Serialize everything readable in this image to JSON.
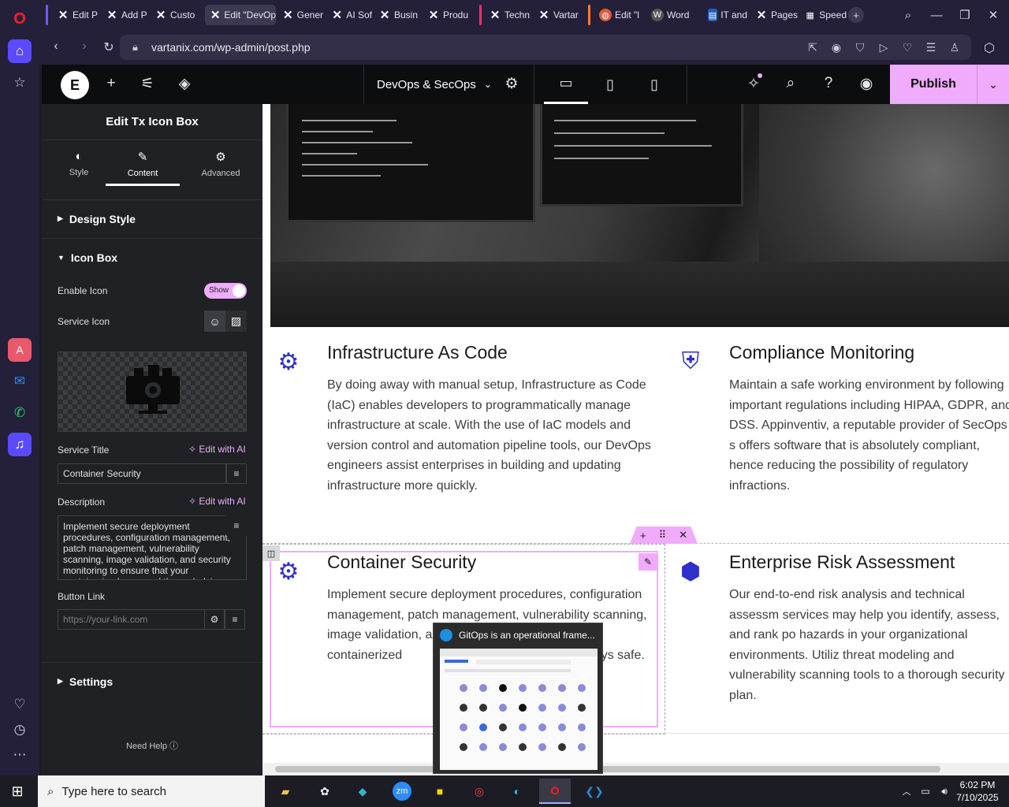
{
  "browser": {
    "tabs": [
      {
        "label": "Edit P",
        "icon": "x-logo-icon"
      },
      {
        "label": "Add P",
        "icon": "x-logo-icon"
      },
      {
        "label": "Custo",
        "icon": "x-logo-icon"
      },
      {
        "label": "Edit \"DevOp",
        "icon": "x-logo-icon",
        "active": true
      },
      {
        "label": "Gener",
        "icon": "x-logo-icon"
      },
      {
        "label": "AI Sof",
        "icon": "x-logo-icon"
      },
      {
        "label": "Busin",
        "icon": "x-logo-icon"
      },
      {
        "label": "Produ",
        "icon": "x-logo-icon"
      },
      {
        "label": "Techn",
        "icon": "x-logo-icon"
      },
      {
        "label": "Vartar",
        "icon": "x-logo-icon"
      },
      {
        "label": "Edit \"l",
        "icon": "globe-icon"
      },
      {
        "label": "Word",
        "icon": "wordpress-icon"
      },
      {
        "label": "IT and",
        "icon": "doc-icon"
      },
      {
        "label": "Pages",
        "icon": "x-logo-icon"
      },
      {
        "label": "Speed",
        "icon": "grid-icon"
      }
    ],
    "url": "vartanix.com/wp-admin/post.php"
  },
  "elementor": {
    "page_name": "DevOps & SecOps",
    "publish_label": "Publish"
  },
  "panel": {
    "title": "Edit Tx Icon Box",
    "tabs": [
      {
        "label": "Style"
      },
      {
        "label": "Content"
      },
      {
        "label": "Advanced"
      }
    ],
    "design_style": "Design Style",
    "icon_box": "Icon Box",
    "enable_icon_label": "Enable Icon",
    "enable_icon_value": "Show",
    "service_icon_label": "Service Icon",
    "service_title_label": "Service Title",
    "edit_with_ai": "Edit with AI",
    "service_title_value": "Container Security",
    "description_label": "Description",
    "description_value": "Implement secure deployment procedures, configuration management, patch management, vulnerability scanning, image validation, and security monitoring to ensure that your containerized apps and the underlying",
    "button_link_label": "Button Link",
    "button_link_placeholder": "https://your-link.com",
    "settings": "Settings",
    "need_help": "Need Help"
  },
  "canvas": {
    "boxes": [
      {
        "title": "Infrastructure As Code",
        "desc": "By doing away with manual setup, Infrastructure as Code (IaC) enables developers to programmatically manage infrastructure at scale. With the use of IaC models and version control and automation pipeline tools, our DevOps engineers assist enterprises in building and updating infrastructure more quickly."
      },
      {
        "title": "Compliance Monitoring",
        "desc": "Maintain a safe working environment by following important regulations including HIPAA, GDPR, and DSS. Appinventiv, a reputable provider of SecOps s offers software that is absolutely compliant, hence reducing the possibility of regulatory infractions."
      },
      {
        "title": "Container Security",
        "desc": "Implement secure deployment procedures, configuration management, patch management, vulnerability scanning, image validation, a                              re that your containerized                              tructure are always safe."
      },
      {
        "title": "Enterprise Risk Assessment",
        "desc": "Our end-to-end risk analysis and technical assessm services may help you identify, assess, and rank po hazards in your organizational environments. Utiliz threat modeling and vulnerability scanning tools to a thorough security plan."
      }
    ]
  },
  "preview_popup": {
    "title": "GitOps is an operational frame..."
  },
  "taskbar": {
    "search_placeholder": "Type here to search",
    "time": "6:02 PM",
    "date": "7/10/2025"
  },
  "colors": {
    "accent": "#f0abfc",
    "icon_blue": "#2f2fc9"
  }
}
